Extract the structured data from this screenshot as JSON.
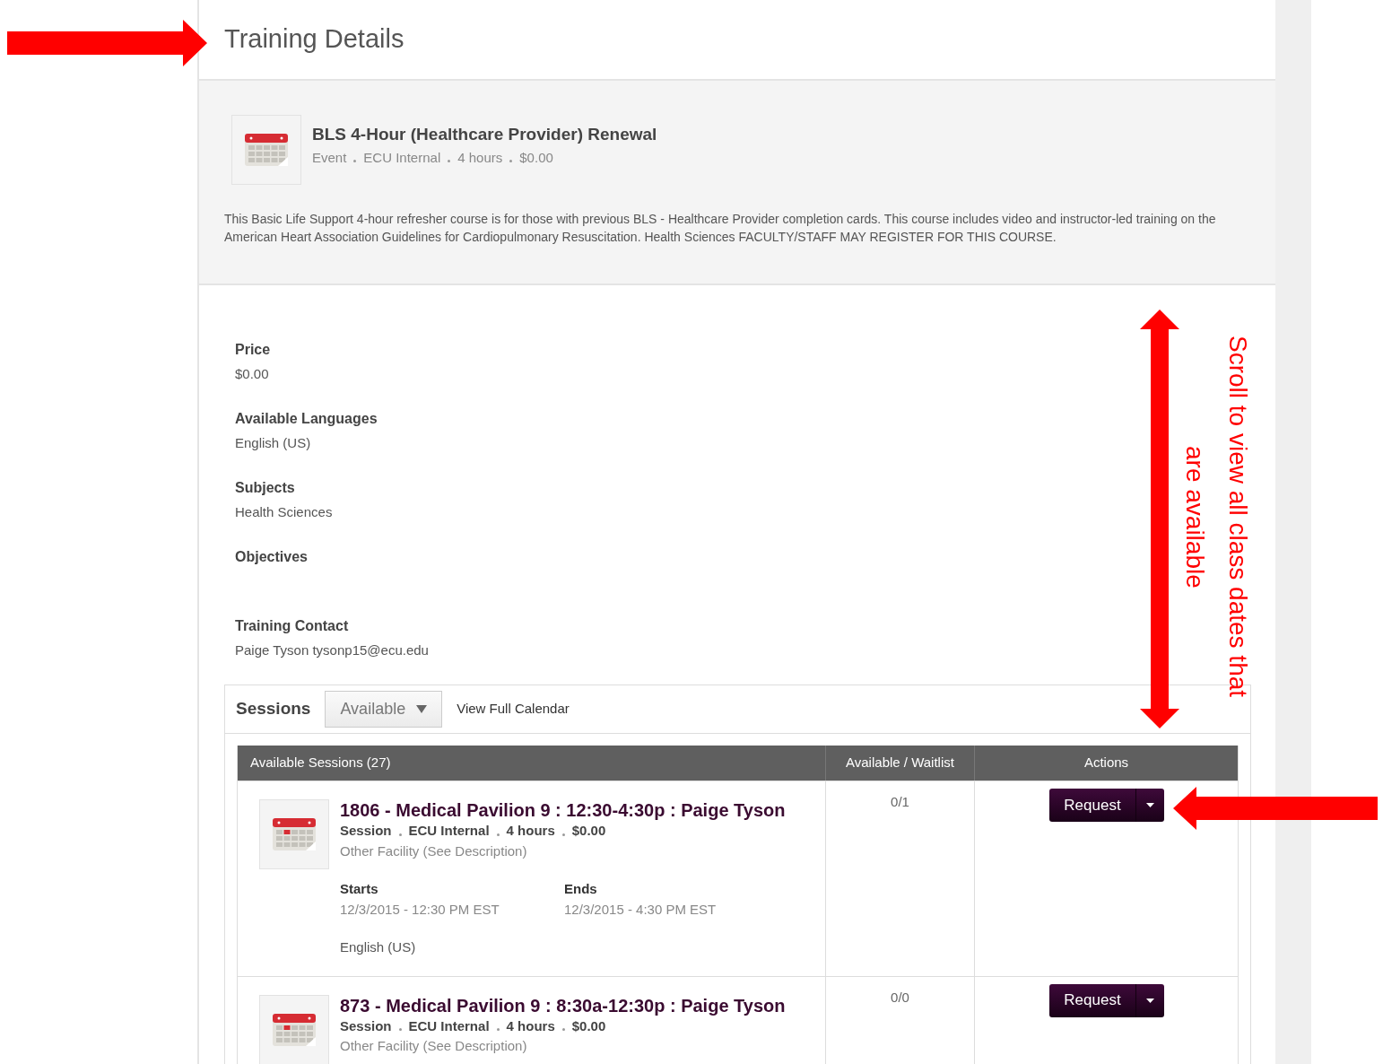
{
  "page_title": "Training Details",
  "course": {
    "title": "BLS 4-Hour (Healthcare Provider) Renewal",
    "meta": [
      "Event",
      "ECU Internal",
      "4 hours",
      "$0.00"
    ],
    "description": "This Basic Life Support 4-hour refresher course is for those with previous BLS - Healthcare Provider completion cards. This course includes video and instructor-led training on the American Heart Association Guidelines for Cardiopulmonary Resuscitation. Health Sciences FACULTY/STAFF MAY REGISTER FOR THIS COURSE."
  },
  "fields": [
    {
      "label": "Price",
      "value": "$0.00"
    },
    {
      "label": "Available Languages",
      "value": "English (US)"
    },
    {
      "label": "Subjects",
      "value": "Health Sciences"
    },
    {
      "label": "Objectives"
    },
    {
      "label": "Training Contact",
      "value": "Paige Tyson tysonp15@ecu.edu"
    }
  ],
  "sessions": {
    "title": "Sessions",
    "filter": "Available",
    "calendar_link": "View Full Calendar",
    "columns": [
      "Available Sessions (27)",
      "Available / Waitlist",
      "Actions"
    ],
    "rows": [
      {
        "title": "1806 - Medical Pavilion 9 : 12:30-4:30p : Paige Tyson",
        "meta": [
          "Session",
          "ECU Internal",
          "4 hours",
          "$0.00"
        ],
        "facility": "Other Facility (See Description)",
        "starts_label": "Starts",
        "starts": "12/3/2015 - 12:30 PM EST",
        "ends_label": "Ends",
        "ends": "12/3/2015 - 4:30 PM EST",
        "language": "English (US)",
        "availability": "0/1",
        "action": "Request"
      },
      {
        "title": "873 - Medical Pavilion 9 : 8:30a-12:30p : Paige Tyson",
        "meta": [
          "Session",
          "ECU Internal",
          "4 hours",
          "$0.00"
        ],
        "facility": "Other Facility (See Description)",
        "availability": "0/0",
        "action": "Request"
      }
    ]
  },
  "annotation": "Scroll to view all class dates that are available"
}
